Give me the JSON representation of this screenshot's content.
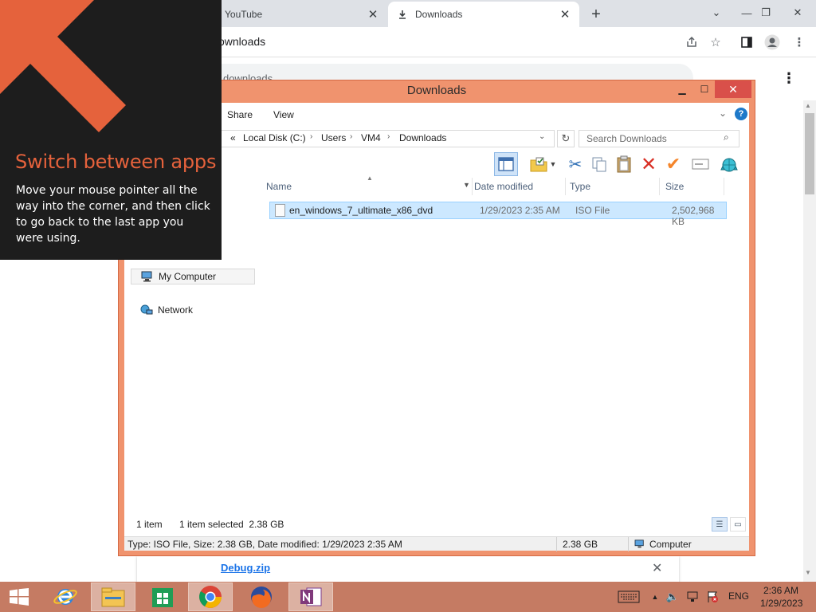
{
  "chrome": {
    "tabs": [
      {
        "title": "YouTube",
        "active": false
      },
      {
        "title": "Downloads",
        "active": true
      }
    ],
    "new_tab_symbol": "+",
    "omnibox_text": "ownloads",
    "downloads_search_text": "downloads",
    "download_item": {
      "filename": "Debug.zip"
    }
  },
  "switch_tip": {
    "title": "Switch between apps",
    "body": "Move your mouse pointer all the way into the corner, and then click to go back to the last app you were using.",
    "accent_color": "#e5623c"
  },
  "explorer": {
    "title": "Downloads",
    "ribbon_tabs": [
      "Share",
      "View"
    ],
    "breadcrumb": [
      "Local Disk (C:)",
      "Users",
      "VM4",
      "Downloads"
    ],
    "breadcrumb_prefix": "«",
    "search_placeholder": "Search Downloads",
    "columns": [
      "Name",
      "Date modified",
      "Type",
      "Size"
    ],
    "files": [
      {
        "name": "en_windows_7_ultimate_x86_dvd",
        "date": "1/29/2023 2:35 AM",
        "type": "ISO File",
        "size": "2,502,968 KB"
      }
    ],
    "nav": [
      {
        "label": "My Computer",
        "selected": true
      },
      {
        "label": "Network",
        "selected": false
      }
    ],
    "status": {
      "count": "1 item",
      "selected": "1 item selected  2.38 GB"
    },
    "info_bar": {
      "details": "Type: ISO File, Size: 2.38 GB, Date modified: 1/29/2023 2:35 AM",
      "size": "2.38 GB",
      "location": "Computer"
    }
  },
  "tray": {
    "language": "ENG",
    "time": "2:36 AM",
    "date": "1/29/2023"
  },
  "colors": {
    "explorer_frame": "#f0936e",
    "taskbar": "#c57b63",
    "selection": "#cce8ff"
  }
}
